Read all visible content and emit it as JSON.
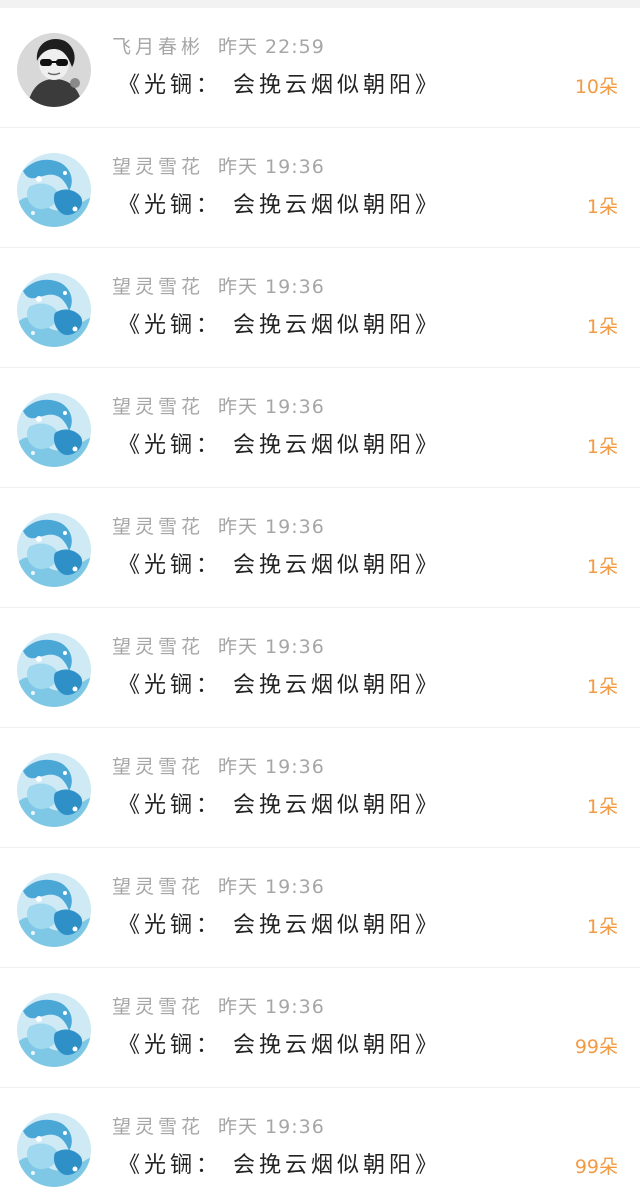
{
  "items": [
    {
      "avatar": "bw-sunglasses-avatar",
      "name": "飞月春彬",
      "time": "昨天 22:59",
      "title": "《光锎： 会挽云烟似朝阳》",
      "count": "10朵"
    },
    {
      "avatar": "blue-anime-avatar",
      "name": "望灵雪花",
      "time": "昨天 19:36",
      "title": "《光锎： 会挽云烟似朝阳》",
      "count": "1朵"
    },
    {
      "avatar": "blue-anime-avatar",
      "name": "望灵雪花",
      "time": "昨天 19:36",
      "title": "《光锎： 会挽云烟似朝阳》",
      "count": "1朵"
    },
    {
      "avatar": "blue-anime-avatar",
      "name": "望灵雪花",
      "time": "昨天 19:36",
      "title": "《光锎： 会挽云烟似朝阳》",
      "count": "1朵"
    },
    {
      "avatar": "blue-anime-avatar",
      "name": "望灵雪花",
      "time": "昨天 19:36",
      "title": "《光锎： 会挽云烟似朝阳》",
      "count": "1朵"
    },
    {
      "avatar": "blue-anime-avatar",
      "name": "望灵雪花",
      "time": "昨天 19:36",
      "title": "《光锎： 会挽云烟似朝阳》",
      "count": "1朵"
    },
    {
      "avatar": "blue-anime-avatar",
      "name": "望灵雪花",
      "time": "昨天 19:36",
      "title": "《光锎： 会挽云烟似朝阳》",
      "count": "1朵"
    },
    {
      "avatar": "blue-anime-avatar",
      "name": "望灵雪花",
      "time": "昨天 19:36",
      "title": "《光锎： 会挽云烟似朝阳》",
      "count": "1朵"
    },
    {
      "avatar": "blue-anime-avatar",
      "name": "望灵雪花",
      "time": "昨天 19:36",
      "title": "《光锎： 会挽云烟似朝阳》",
      "count": "99朵"
    },
    {
      "avatar": "blue-anime-avatar",
      "name": "望灵雪花",
      "time": "昨天 19:36",
      "title": "《光锎： 会挽云烟似朝阳》",
      "count": "99朵"
    }
  ],
  "colors": {
    "accent": "#f39a45",
    "meta_text": "#a6a6a6",
    "title_text": "#222222",
    "row_background": "#ffffff",
    "page_background": "#f4f4f4"
  }
}
